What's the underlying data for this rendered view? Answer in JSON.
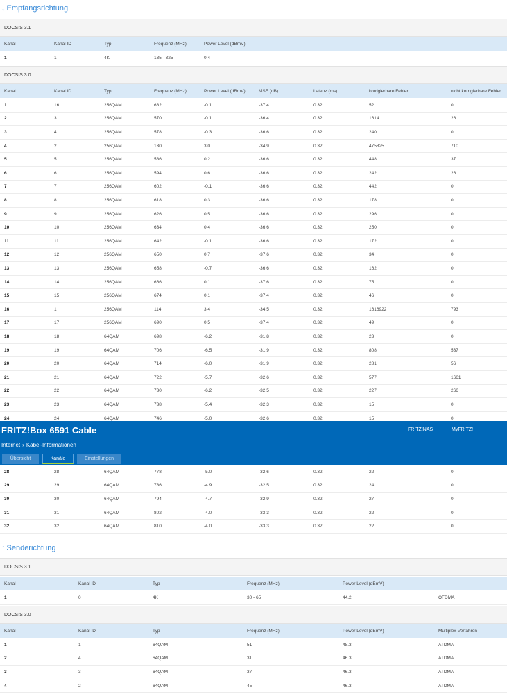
{
  "downstream": {
    "title": "Empfangsrichtung",
    "arrow": "↓",
    "docsis31": {
      "label": "DOCSIS 3.1",
      "headers": [
        "Kanal",
        "Kanal ID",
        "Typ",
        "Frequenz (MHz)",
        "Power Level (dBmV)"
      ],
      "rows": [
        [
          "1",
          "1",
          "4K",
          "135 - 325",
          "0.4"
        ]
      ]
    },
    "docsis30": {
      "label": "DOCSIS 3.0",
      "headers": [
        "Kanal",
        "Kanal ID",
        "Typ",
        "Frequenz (MHz)",
        "Power Level (dBmV)",
        "MSE (dB)",
        "Latenz (ms)",
        "korrigierbare Fehler",
        "nicht korrigierbare Fehler"
      ],
      "rows": [
        [
          "1",
          "16",
          "256QAM",
          "682",
          "-0.1",
          "-37.4",
          "0.32",
          "52",
          "0"
        ],
        [
          "2",
          "3",
          "256QAM",
          "570",
          "-0.1",
          "-36.4",
          "0.32",
          "1614",
          "26"
        ],
        [
          "3",
          "4",
          "256QAM",
          "578",
          "-0.3",
          "-36.6",
          "0.32",
          "240",
          "0"
        ],
        [
          "4",
          "2",
          "256QAM",
          "130",
          "3.0",
          "-34.9",
          "0.32",
          "475825",
          "710"
        ],
        [
          "5",
          "5",
          "256QAM",
          "586",
          "0.2",
          "-36.6",
          "0.32",
          "448",
          "37"
        ],
        [
          "6",
          "6",
          "256QAM",
          "594",
          "0.6",
          "-36.6",
          "0.32",
          "242",
          "26"
        ],
        [
          "7",
          "7",
          "256QAM",
          "602",
          "-0.1",
          "-36.6",
          "0.32",
          "442",
          "0"
        ],
        [
          "8",
          "8",
          "256QAM",
          "618",
          "0.3",
          "-36.6",
          "0.32",
          "178",
          "0"
        ],
        [
          "9",
          "9",
          "256QAM",
          "626",
          "0.5",
          "-36.6",
          "0.32",
          "296",
          "0"
        ],
        [
          "10",
          "10",
          "256QAM",
          "634",
          "0.4",
          "-36.6",
          "0.32",
          "250",
          "0"
        ],
        [
          "11",
          "11",
          "256QAM",
          "642",
          "-0.1",
          "-36.6",
          "0.32",
          "172",
          "0"
        ],
        [
          "12",
          "12",
          "256QAM",
          "650",
          "0.7",
          "-37.6",
          "0.32",
          "34",
          "0"
        ],
        [
          "13",
          "13",
          "256QAM",
          "658",
          "-0.7",
          "-36.6",
          "0.32",
          "162",
          "0"
        ],
        [
          "14",
          "14",
          "256QAM",
          "666",
          "0.1",
          "-37.6",
          "0.32",
          "75",
          "0"
        ],
        [
          "15",
          "15",
          "256QAM",
          "674",
          "0.1",
          "-37.4",
          "0.32",
          "46",
          "0"
        ],
        [
          "16",
          "1",
          "256QAM",
          "114",
          "3.4",
          "-34.5",
          "0.32",
          "1616922",
          "793"
        ],
        [
          "17",
          "17",
          "256QAM",
          "690",
          "0.5",
          "-37.4",
          "0.32",
          "49",
          "0"
        ],
        [
          "18",
          "18",
          "64QAM",
          "698",
          "-6.2",
          "-31.8",
          "0.32",
          "23",
          "0"
        ],
        [
          "19",
          "19",
          "64QAM",
          "706",
          "-6.5",
          "-31.9",
          "0.32",
          "808",
          "537"
        ],
        [
          "20",
          "20",
          "64QAM",
          "714",
          "-6.0",
          "-31.9",
          "0.32",
          "281",
          "56"
        ],
        [
          "21",
          "21",
          "64QAM",
          "722",
          "-5.7",
          "-32.6",
          "0.32",
          "577",
          "1661"
        ],
        [
          "22",
          "22",
          "64QAM",
          "730",
          "-6.2",
          "-32.5",
          "0.32",
          "227",
          "266"
        ],
        [
          "23",
          "23",
          "64QAM",
          "738",
          "-5.4",
          "-32.3",
          "0.32",
          "15",
          "0"
        ],
        [
          "24",
          "24",
          "64QAM",
          "746",
          "-5.0",
          "-32.6",
          "0.32",
          "15",
          "0"
        ]
      ],
      "rows_after": [
        [
          "28",
          "28",
          "64QAM",
          "778",
          "-5.0",
          "-32.6",
          "0.32",
          "22",
          "0"
        ],
        [
          "29",
          "29",
          "64QAM",
          "786",
          "-4.9",
          "-32.5",
          "0.32",
          "24",
          "0"
        ],
        [
          "30",
          "30",
          "64QAM",
          "794",
          "-4.7",
          "-32.9",
          "0.32",
          "27",
          "0"
        ],
        [
          "31",
          "31",
          "64QAM",
          "802",
          "-4.0",
          "-33.3",
          "0.32",
          "22",
          "0"
        ],
        [
          "32",
          "32",
          "64QAM",
          "810",
          "-4.0",
          "-33.3",
          "0.32",
          "22",
          "0"
        ]
      ]
    }
  },
  "overlay": {
    "brand": "FRITZ!Box 6591 Cable",
    "links": [
      "FRITZ!NAS",
      "MyFRITZ!"
    ],
    "breadcrumb": [
      "Internet",
      "Kabel-Informationen"
    ],
    "tabs": [
      {
        "label": "Übersicht",
        "active": false
      },
      {
        "label": "Kanäle",
        "active": true
      },
      {
        "label": "Einstellungen",
        "active": false
      }
    ]
  },
  "upstream": {
    "title": "Senderichtung",
    "arrow": "↑",
    "docsis31": {
      "label": "DOCSIS 3.1",
      "headers": [
        "Kanal",
        "Kanal ID",
        "Typ",
        "Frequenz (MHz)",
        "Power Level (dBmV)",
        ""
      ],
      "rows": [
        [
          "1",
          "0",
          "4K",
          "30 - 65",
          "44.2",
          "OFDMA"
        ]
      ]
    },
    "docsis30": {
      "label": "DOCSIS 3.0",
      "headers": [
        "Kanal",
        "Kanal ID",
        "Typ",
        "Frequenz (MHz)",
        "Power Level (dBmV)",
        "Multiplex-Verfahren"
      ],
      "rows": [
        [
          "1",
          "1",
          "64QAM",
          "51",
          "48.3",
          "ATDMA"
        ],
        [
          "2",
          "4",
          "64QAM",
          "31",
          "46.3",
          "ATDMA"
        ],
        [
          "3",
          "3",
          "64QAM",
          "37",
          "46.3",
          "ATDMA"
        ],
        [
          "4",
          "2",
          "64QAM",
          "45",
          "46.3",
          "ATDMA"
        ]
      ]
    }
  },
  "colors": {
    "accent": "#3a8bd8",
    "header_bar": "#0068b8",
    "table_header": "#d9e9f7",
    "active_tab_underline": "#a6d23a"
  }
}
